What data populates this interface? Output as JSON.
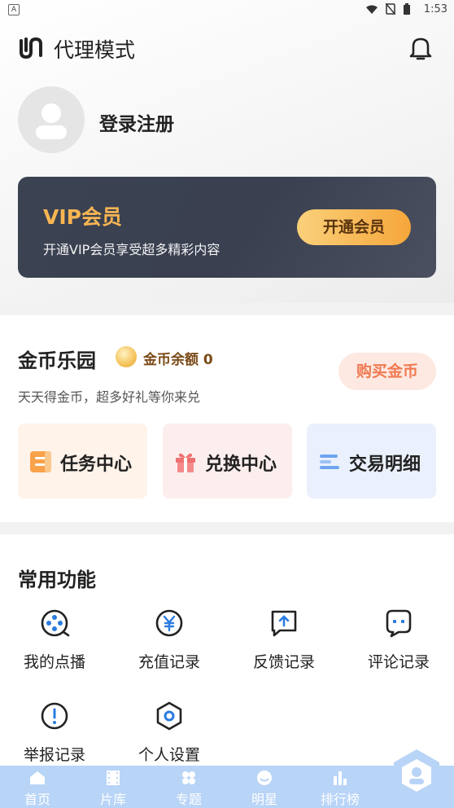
{
  "status_bar": {
    "notification_letter": "A",
    "time": "1:53",
    "icons": [
      "wifi-icon",
      "no-sim-icon",
      "battery-icon"
    ]
  },
  "header": {
    "title": "代理模式",
    "icons": [
      "brand-logo-icon",
      "bell-icon"
    ]
  },
  "profile": {
    "login_text": "登录注册"
  },
  "vip_card": {
    "title": "VIP会员",
    "subtitle": "开通VIP会员享受超多精彩内容",
    "button_label": "开通会员"
  },
  "coin_park": {
    "title": "金币乐园",
    "balance_label": "金币余额 0",
    "subtitle": "天天得金币，超多好礼等你来兑",
    "buy_button": "购买金币",
    "tiles": [
      {
        "label": "任务中心",
        "icon": "task-icon"
      },
      {
        "label": "兑换中心",
        "icon": "gift-icon"
      },
      {
        "label": "交易明细",
        "icon": "list-icon"
      }
    ]
  },
  "common_functions": {
    "title": "常用功能",
    "items": [
      {
        "label": "我的点播",
        "icon": "film-reel-icon"
      },
      {
        "label": "充值记录",
        "icon": "yen-icon"
      },
      {
        "label": "反馈记录",
        "icon": "feedback-icon"
      },
      {
        "label": "评论记录",
        "icon": "comment-icon"
      },
      {
        "label": "举报记录",
        "icon": "report-icon"
      },
      {
        "label": "个人设置",
        "icon": "settings-icon"
      }
    ]
  },
  "bottom_nav": {
    "items": [
      {
        "label": "首页",
        "icon": "home-icon"
      },
      {
        "label": "片库",
        "icon": "film-icon"
      },
      {
        "label": "专题",
        "icon": "topic-icon"
      },
      {
        "label": "明星",
        "icon": "star-face-icon"
      },
      {
        "label": "排行榜",
        "icon": "ranking-icon"
      }
    ],
    "active_icon": "profile-icon"
  },
  "colors": {
    "vip_gold": "#f7b552",
    "buy_coin_text": "#f07a52",
    "nav_bg": "#b8d4f7",
    "func_blue": "#2b7be0"
  }
}
